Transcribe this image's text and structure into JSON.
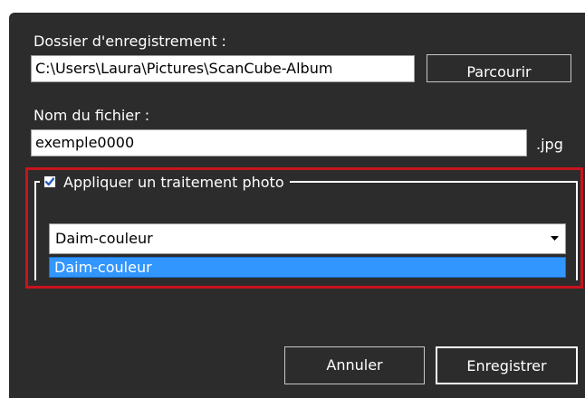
{
  "save_folder": {
    "label": "Dossier d'enregistrement :",
    "value": "C:\\Users\\Laura\\Pictures\\ScanCube-Album",
    "browse_label": "Parcourir"
  },
  "file_name": {
    "label": "Nom du fichier :",
    "value": "exemple0000",
    "extension": ".jpg"
  },
  "photo_processing": {
    "checkbox_label": "Appliquer un traitement photo",
    "checked": true,
    "selected": "Daim-couleur",
    "options": [
      "Daim-couleur"
    ]
  },
  "footer": {
    "cancel_label": "Annuler",
    "save_label": "Enregistrer"
  },
  "colors": {
    "panel_background": "#2c2c2c",
    "highlight_border": "#c8141e",
    "selection": "#3296ff",
    "checkbox_mark": "#2a5fbf"
  }
}
